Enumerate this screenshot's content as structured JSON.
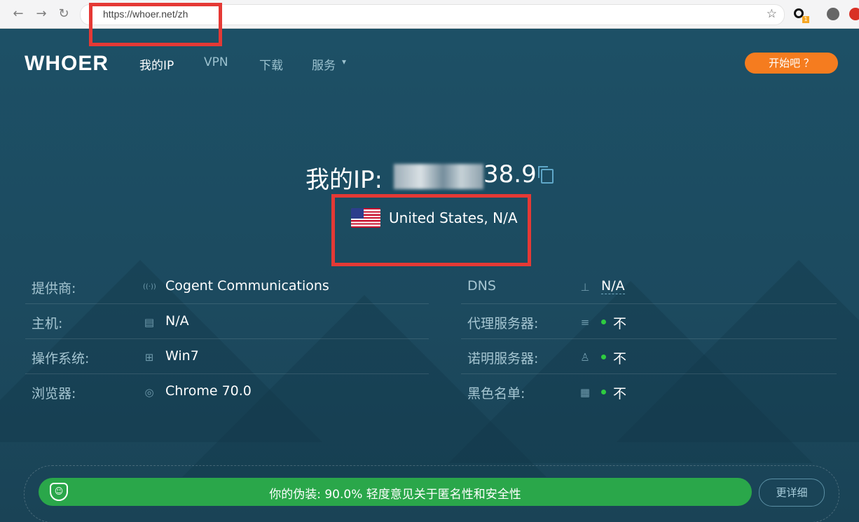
{
  "browser": {
    "back_icon": "←",
    "forward_icon": "→",
    "reload_icon": "↻",
    "url": "https://whoer.net/zh",
    "star_icon": "☆",
    "extension_badge": "1"
  },
  "nav": {
    "logo": "WHOER",
    "items": [
      "我的IP",
      "VPN",
      "下载",
      "服务"
    ],
    "services_caret": "▾",
    "cta": "开始吧 ？"
  },
  "hero": {
    "ip_label": "我的IP:",
    "ip_visible_end": "38.9",
    "location": "United States, N/A"
  },
  "info_left": [
    {
      "label": "提供商:",
      "icon": "((·))",
      "value": "Cogent Communications"
    },
    {
      "label": "主机:",
      "icon": "▤",
      "value": "N/A"
    },
    {
      "label": "操作系统:",
      "icon": "⊞",
      "value": "Win7"
    },
    {
      "label": "浏览器:",
      "icon": "◎",
      "value": "Chrome 70.0"
    }
  ],
  "info_right": [
    {
      "label": "DNS",
      "icon": "⊥",
      "value": "N/A"
    },
    {
      "label": "代理服务器:",
      "icon": "≡",
      "value": "不"
    },
    {
      "label": "诺明服务器:",
      "icon": "♙",
      "value": "不"
    },
    {
      "label": "黑色名单:",
      "icon": "▦",
      "value": "不"
    }
  ],
  "disguise": {
    "icon": "☺",
    "text": "你的伪装: 90.0% 轻度意见关于匿名性和安全性",
    "detail_button": "更详细"
  }
}
